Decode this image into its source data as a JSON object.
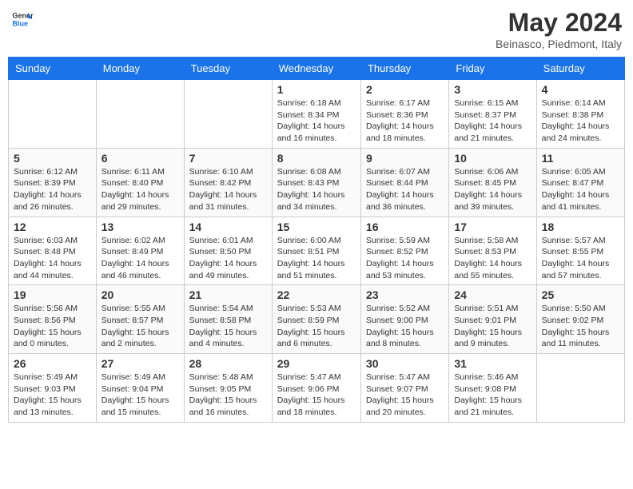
{
  "header": {
    "logo_line1": "General",
    "logo_line2": "Blue",
    "month_title": "May 2024",
    "location": "Beinasco, Piedmont, Italy"
  },
  "columns": [
    "Sunday",
    "Monday",
    "Tuesday",
    "Wednesday",
    "Thursday",
    "Friday",
    "Saturday"
  ],
  "weeks": [
    [
      {
        "day": "",
        "info": ""
      },
      {
        "day": "",
        "info": ""
      },
      {
        "day": "",
        "info": ""
      },
      {
        "day": "1",
        "info": "Sunrise: 6:18 AM\nSunset: 8:34 PM\nDaylight: 14 hours\nand 16 minutes."
      },
      {
        "day": "2",
        "info": "Sunrise: 6:17 AM\nSunset: 8:36 PM\nDaylight: 14 hours\nand 18 minutes."
      },
      {
        "day": "3",
        "info": "Sunrise: 6:15 AM\nSunset: 8:37 PM\nDaylight: 14 hours\nand 21 minutes."
      },
      {
        "day": "4",
        "info": "Sunrise: 6:14 AM\nSunset: 8:38 PM\nDaylight: 14 hours\nand 24 minutes."
      }
    ],
    [
      {
        "day": "5",
        "info": "Sunrise: 6:12 AM\nSunset: 8:39 PM\nDaylight: 14 hours\nand 26 minutes."
      },
      {
        "day": "6",
        "info": "Sunrise: 6:11 AM\nSunset: 8:40 PM\nDaylight: 14 hours\nand 29 minutes."
      },
      {
        "day": "7",
        "info": "Sunrise: 6:10 AM\nSunset: 8:42 PM\nDaylight: 14 hours\nand 31 minutes."
      },
      {
        "day": "8",
        "info": "Sunrise: 6:08 AM\nSunset: 8:43 PM\nDaylight: 14 hours\nand 34 minutes."
      },
      {
        "day": "9",
        "info": "Sunrise: 6:07 AM\nSunset: 8:44 PM\nDaylight: 14 hours\nand 36 minutes."
      },
      {
        "day": "10",
        "info": "Sunrise: 6:06 AM\nSunset: 8:45 PM\nDaylight: 14 hours\nand 39 minutes."
      },
      {
        "day": "11",
        "info": "Sunrise: 6:05 AM\nSunset: 8:47 PM\nDaylight: 14 hours\nand 41 minutes."
      }
    ],
    [
      {
        "day": "12",
        "info": "Sunrise: 6:03 AM\nSunset: 8:48 PM\nDaylight: 14 hours\nand 44 minutes."
      },
      {
        "day": "13",
        "info": "Sunrise: 6:02 AM\nSunset: 8:49 PM\nDaylight: 14 hours\nand 46 minutes."
      },
      {
        "day": "14",
        "info": "Sunrise: 6:01 AM\nSunset: 8:50 PM\nDaylight: 14 hours\nand 49 minutes."
      },
      {
        "day": "15",
        "info": "Sunrise: 6:00 AM\nSunset: 8:51 PM\nDaylight: 14 hours\nand 51 minutes."
      },
      {
        "day": "16",
        "info": "Sunrise: 5:59 AM\nSunset: 8:52 PM\nDaylight: 14 hours\nand 53 minutes."
      },
      {
        "day": "17",
        "info": "Sunrise: 5:58 AM\nSunset: 8:53 PM\nDaylight: 14 hours\nand 55 minutes."
      },
      {
        "day": "18",
        "info": "Sunrise: 5:57 AM\nSunset: 8:55 PM\nDaylight: 14 hours\nand 57 minutes."
      }
    ],
    [
      {
        "day": "19",
        "info": "Sunrise: 5:56 AM\nSunset: 8:56 PM\nDaylight: 15 hours\nand 0 minutes."
      },
      {
        "day": "20",
        "info": "Sunrise: 5:55 AM\nSunset: 8:57 PM\nDaylight: 15 hours\nand 2 minutes."
      },
      {
        "day": "21",
        "info": "Sunrise: 5:54 AM\nSunset: 8:58 PM\nDaylight: 15 hours\nand 4 minutes."
      },
      {
        "day": "22",
        "info": "Sunrise: 5:53 AM\nSunset: 8:59 PM\nDaylight: 15 hours\nand 6 minutes."
      },
      {
        "day": "23",
        "info": "Sunrise: 5:52 AM\nSunset: 9:00 PM\nDaylight: 15 hours\nand 8 minutes."
      },
      {
        "day": "24",
        "info": "Sunrise: 5:51 AM\nSunset: 9:01 PM\nDaylight: 15 hours\nand 9 minutes."
      },
      {
        "day": "25",
        "info": "Sunrise: 5:50 AM\nSunset: 9:02 PM\nDaylight: 15 hours\nand 11 minutes."
      }
    ],
    [
      {
        "day": "26",
        "info": "Sunrise: 5:49 AM\nSunset: 9:03 PM\nDaylight: 15 hours\nand 13 minutes."
      },
      {
        "day": "27",
        "info": "Sunrise: 5:49 AM\nSunset: 9:04 PM\nDaylight: 15 hours\nand 15 minutes."
      },
      {
        "day": "28",
        "info": "Sunrise: 5:48 AM\nSunset: 9:05 PM\nDaylight: 15 hours\nand 16 minutes."
      },
      {
        "day": "29",
        "info": "Sunrise: 5:47 AM\nSunset: 9:06 PM\nDaylight: 15 hours\nand 18 minutes."
      },
      {
        "day": "30",
        "info": "Sunrise: 5:47 AM\nSunset: 9:07 PM\nDaylight: 15 hours\nand 20 minutes."
      },
      {
        "day": "31",
        "info": "Sunrise: 5:46 AM\nSunset: 9:08 PM\nDaylight: 15 hours\nand 21 minutes."
      },
      {
        "day": "",
        "info": ""
      }
    ]
  ]
}
